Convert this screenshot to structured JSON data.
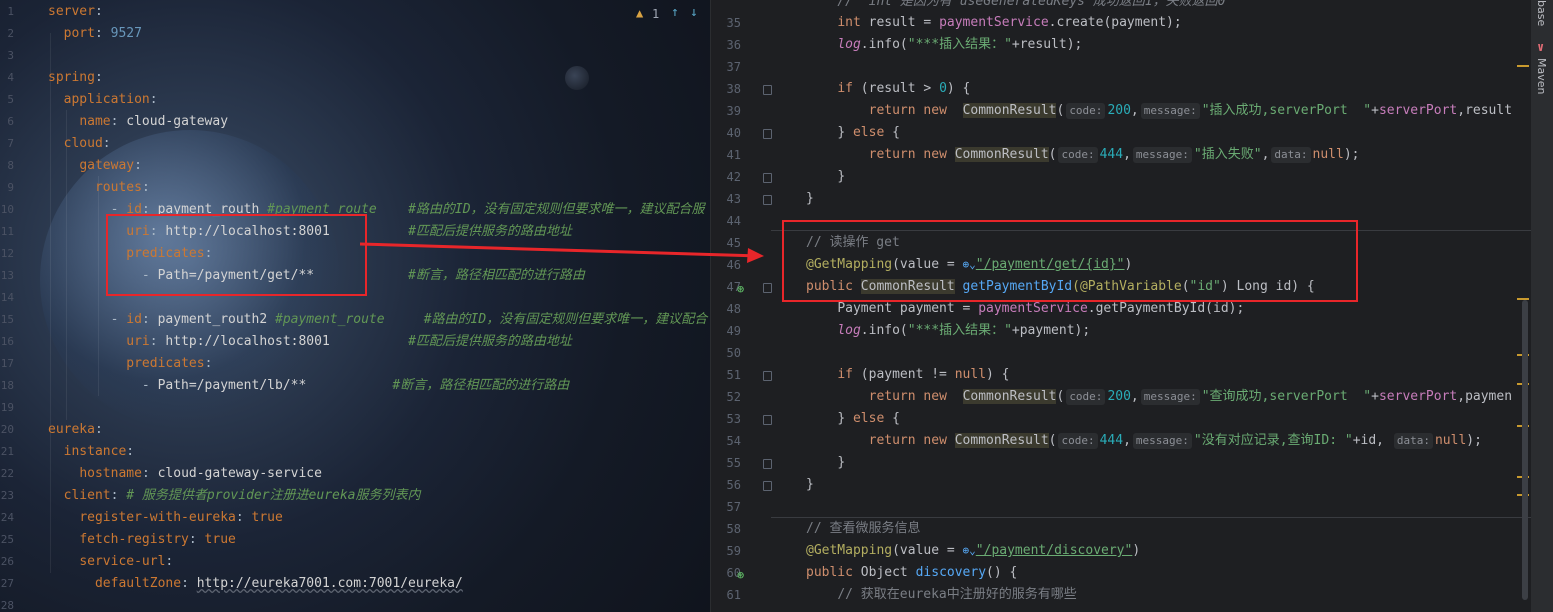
{
  "yaml_editor": {
    "warning_count": "1",
    "line_numbers": [
      "1",
      "2",
      "3",
      "4",
      "5",
      "6",
      "7",
      "8",
      "9",
      "10",
      "11",
      "12",
      "13",
      "14",
      "15",
      "16",
      "17",
      "18",
      "19",
      "20",
      "21",
      "22",
      "23",
      "24",
      "25",
      "26",
      "27",
      "28"
    ],
    "lines": {
      "l1_key": "server",
      "l2_key": "port",
      "l2_val": "9527",
      "l4_key": "spring",
      "l5_key": "application",
      "l6_key": "name",
      "l6_val": "cloud-gateway",
      "l7_key": "cloud",
      "l8_key": "gateway",
      "l9_key": "routes",
      "l10_key": "id",
      "l10_val": "payment_routh",
      "l10_c1": "#payment_route",
      "l10_c2": "#路由的ID，没有固定规则但要求唯一，建议配合服",
      "l11_key": "uri",
      "l11_val": "http://localhost:8001",
      "l11_c": "#匹配后提供服务的路由地址",
      "l12_key": "predicates",
      "l13_val": "Path=/payment/get/**",
      "l13_c": "#断言，路径相匹配的进行路由",
      "l15_key": "id",
      "l15_val": "payment_routh2",
      "l15_c1": "#payment_route",
      "l15_c2": "#路由的ID，没有固定规则但要求唯一，建议配合",
      "l16_key": "uri",
      "l16_val": "http://localhost:8001",
      "l16_c": "#匹配后提供服务的路由地址",
      "l17_key": "predicates",
      "l18_val": "Path=/payment/lb/**",
      "l18_c": "#断言，路径相匹配的进行路由",
      "l20_key": "eureka",
      "l21_key": "instance",
      "l22_key": "hostname",
      "l22_val": "cloud-gateway-service",
      "l23_key": "client",
      "l23_c": "# 服务提供者provider注册进eureka服务列表内",
      "l24_key": "register-with-eureka",
      "l24_val": "true",
      "l25_key": "fetch-registry",
      "l25_val": "true",
      "l26_key": "service-url",
      "l27_key": "defaultZone",
      "l27_val": "http://eureka7001.com:7001/eureka/"
    }
  },
  "java_editor": {
    "line_numbers": [
      "35",
      "36",
      "37",
      "38",
      "39",
      "40",
      "41",
      "42",
      "43",
      "44",
      "45",
      "46",
      "47",
      "48",
      "49",
      "50",
      "51",
      "52",
      "53",
      "54",
      "55",
      "56",
      "57",
      "58",
      "59",
      "60",
      "61"
    ],
    "l34_partial": "//  int 是因为有 useGeneratedKeys 成功返回1，失败返回0",
    "l35": {
      "t1": "int",
      "t2": " result = ",
      "t3": "paymentService",
      "t4": ".create(payment);"
    },
    "l36": {
      "t1": "log",
      "t2": ".info(",
      "t3": "\"***插入结果：\"",
      "t4": "+result);"
    },
    "l38": {
      "t1": "if",
      "t2": " (result > ",
      "t3": "0",
      "t4": ") {"
    },
    "l39": {
      "t1": "return new",
      "t2": "CommonResult",
      "h1": "code:",
      "n1": "200",
      "h2": "message:",
      "s1": "\"插入成功,serverPort  \"",
      "t3": "+",
      "f1": "serverPort",
      "t4": ",result"
    },
    "l40": {
      "t1": "} ",
      "t2": "else",
      "t3": " {"
    },
    "l41": {
      "t1": "return new",
      "t2": "CommonResult",
      "h1": "code:",
      "n1": "444",
      "h2": "message:",
      "s1": "\"插入失败\"",
      "h3": "data:",
      "t3": "null",
      "t4": ");"
    },
    "l42": "}",
    "l43": "}",
    "l45": "// 读操作 get",
    "l46": {
      "a1": "@GetMapping",
      "t1": "(value = ",
      "s1": "\"/payment/get/{id}\"",
      "t2": ")"
    },
    "l47": {
      "t1": "public",
      "t2": "CommonResult",
      "t3": "getPaymentById",
      "a1": "(@PathVariable",
      "t4": "(",
      "s1": "\"id\"",
      "t5": ") Long id) {"
    },
    "l48": {
      "t1": "Payment payment = ",
      "t2": "paymentService",
      "t3": ".getPaymentById(id);"
    },
    "l49": {
      "t1": "log",
      "t2": ".info(",
      "t3": "\"***插入结果：\"",
      "t4": "+payment);"
    },
    "l51": {
      "t1": "if",
      "t2": " (payment != ",
      "t3": "null",
      "t4": ") {"
    },
    "l52": {
      "t1": "return new",
      "t2": "CommonResult",
      "h1": "code:",
      "n1": "200",
      "h2": "message:",
      "s1": "\"查询成功,serverPort  \"",
      "t3": "+",
      "f1": "serverPort",
      "t4": ",paymen"
    },
    "l53": {
      "t1": "} ",
      "t2": "else",
      "t3": " {"
    },
    "l54": {
      "t1": "return new",
      "t2": "CommonResult",
      "h1": "code:",
      "n1": "444",
      "h2": "message:",
      "s1": "\"没有对应记录,查询ID: \"",
      "t3": "+id, ",
      "h3": "data:",
      "t4": "null",
      "t5": ");"
    },
    "l55": "}",
    "l56": "}",
    "l58": "// 查看微服务信息",
    "l59": {
      "a1": "@GetMapping",
      "t1": "(value = ",
      "s1": "\"/payment/discovery\"",
      "t2": ")"
    },
    "l60": {
      "t1": "public",
      "t2": " Object ",
      "t3": "discovery",
      "t4": "() {"
    },
    "l61": "// 获取在eureka中注册好的服务有哪些"
  },
  "tool_strip": {
    "base_label": "base",
    "maven_label": "Maven"
  },
  "colors": {
    "annotation_red": "#e8262a",
    "editor_bg": "#1e1f22"
  }
}
